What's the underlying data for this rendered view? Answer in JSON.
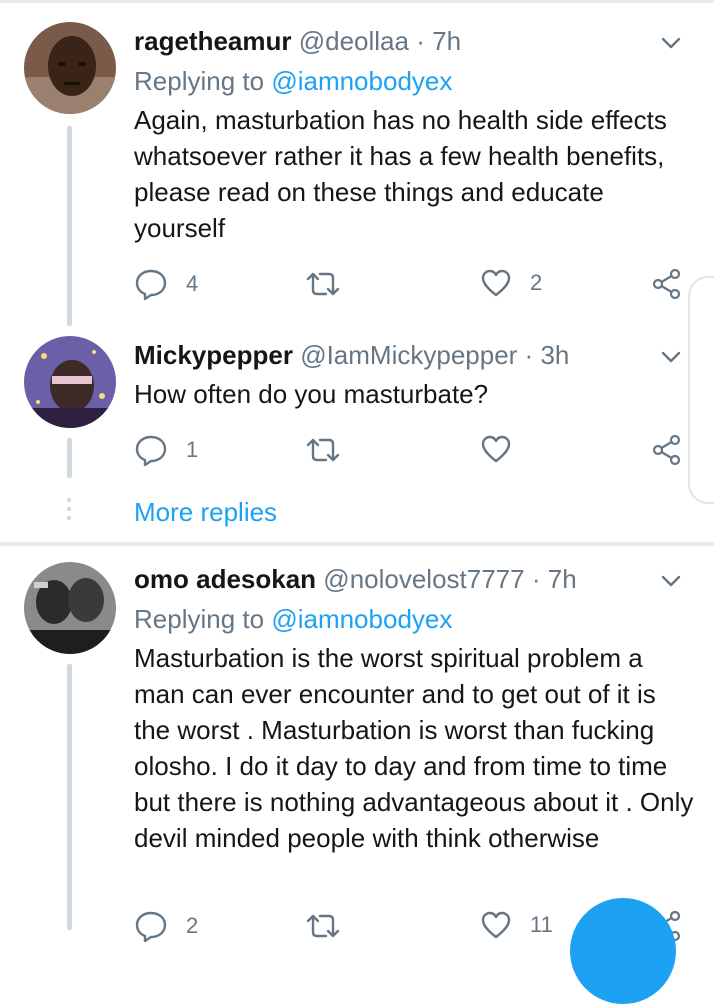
{
  "tweets": [
    {
      "name": "ragetheamur",
      "handle": "@deollaa",
      "sep": "·",
      "time": "7h",
      "reply_prefix": "Replying to",
      "reply_to": "@iamnobodyex",
      "text": "Again, masturbation has no health side effects whatsoever rather it has a few health benefits, please read on these things and educate yourself",
      "replies": "4",
      "retweets": "",
      "likes": "2"
    },
    {
      "name": "Mickypepper",
      "handle": "@IamMickypepper",
      "sep": "·",
      "time": "3h",
      "text": "How often do you masturbate?",
      "replies": "1",
      "retweets": "",
      "likes": ""
    },
    {
      "name": "omo adesokan",
      "handle": "@nolovelost7777",
      "sep": "·",
      "time": "7h",
      "reply_prefix": "Replying to",
      "reply_to": "@iamnobodyex",
      "text": "Masturbation is the worst spiritual problem a man can ever encounter and to get out of it is the worst . Masturbation is worst than fucking olosho. I do it day to day and from time to time but there is nothing advantageous about it . Only devil minded people with think otherwise",
      "replies": "2",
      "retweets": "",
      "likes": "11"
    }
  ],
  "more_replies_label": "More replies",
  "icons": {
    "reply": "reply-icon",
    "retweet": "retweet-icon",
    "like": "heart-icon",
    "share": "share-icon",
    "caret": "chevron-down-icon"
  },
  "colors": {
    "accent": "#1da1f2",
    "secondary_text": "#657786",
    "primary_text": "#14171a",
    "divider": "#e6ecf0"
  }
}
